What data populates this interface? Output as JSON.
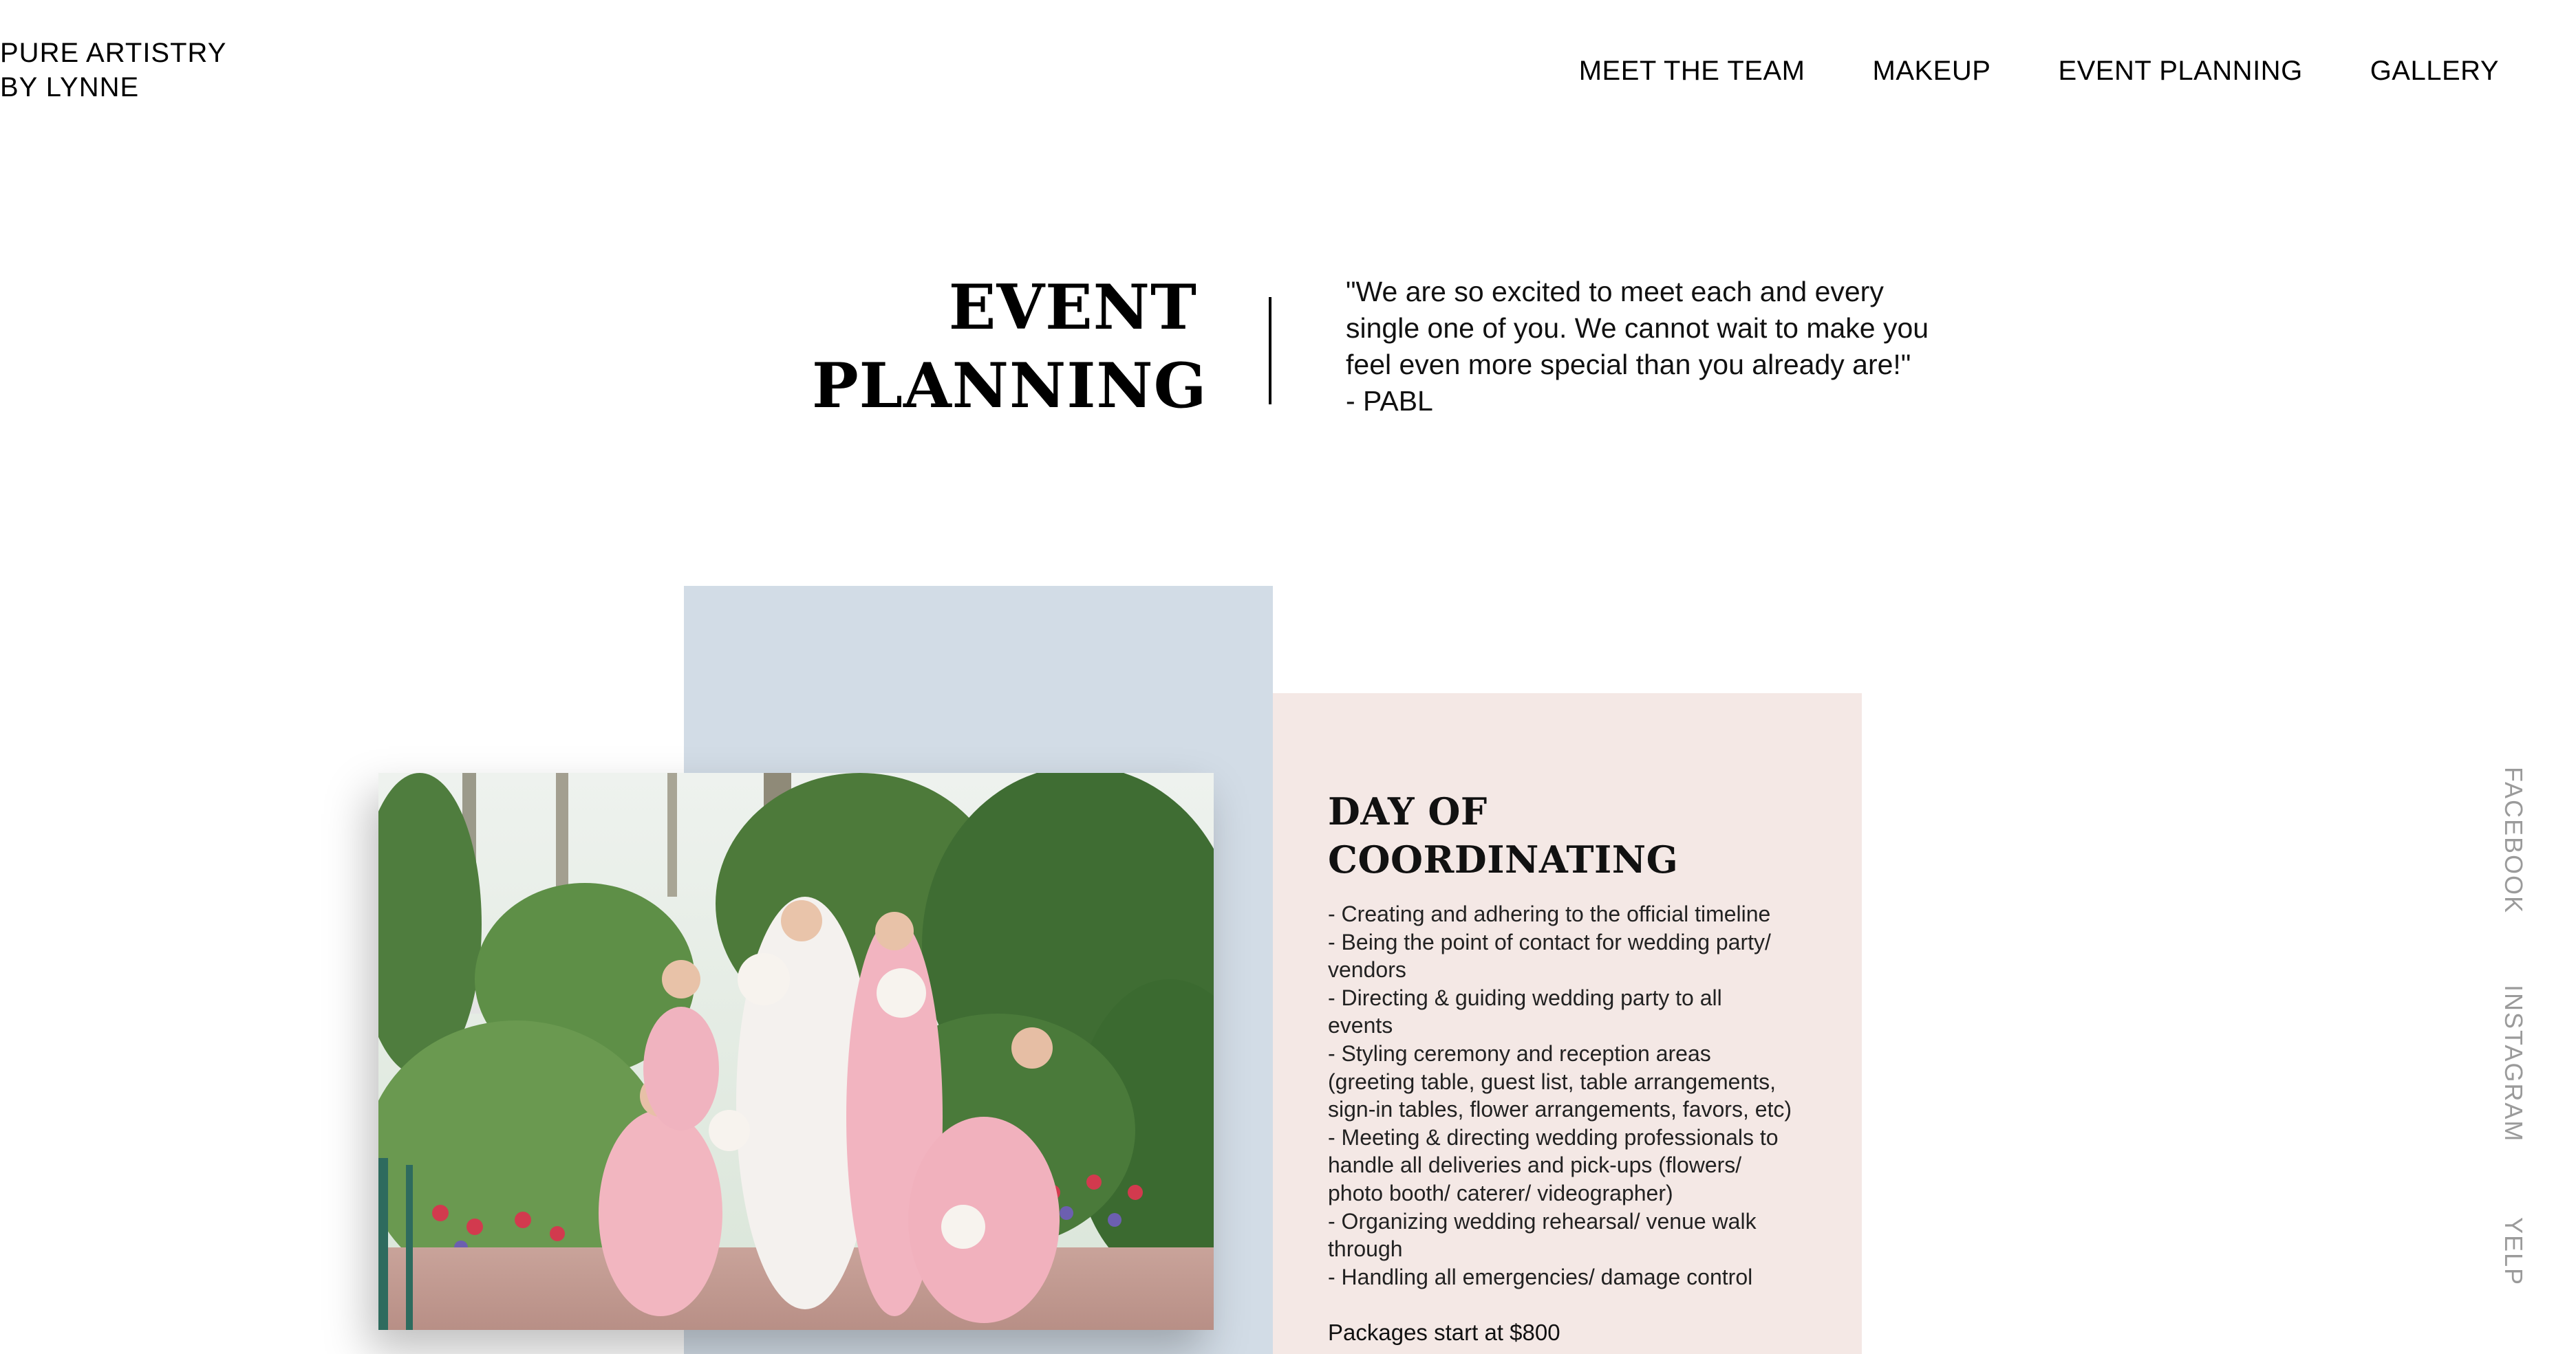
{
  "brand": {
    "line1": "PURE ARTISTRY",
    "line2": "BY LYNNE"
  },
  "nav": {
    "items": [
      "MEET THE TEAM",
      "MAKEUP",
      "EVENT PLANNING",
      "GALLERY"
    ]
  },
  "hero": {
    "title_line1": "EVENT",
    "title_line2": "PLANNING",
    "quote_lines": [
      "\"We are so excited to meet each and every",
      "single one of you. We cannot wait to make you",
      "feel even more special than you already are!\"",
      "- PABL"
    ]
  },
  "photo": {
    "icon": "bridal-party-photo"
  },
  "service": {
    "title": "DAY OF COORDINATING",
    "lines": [
      "- Creating and adhering to the official timeline",
      "- Being the point of contact for wedding party/",
      "vendors",
      "- Directing & guiding wedding party to all",
      "events",
      "- Styling ceremony and reception areas",
      "(greeting table, guest list, table arrangements,",
      "sign-in tables, flower arrangements, favors, etc)",
      "- Meeting & directing wedding professionals to",
      "handle all deliveries and pick-ups (flowers/",
      "photo booth/ caterer/ videographer)",
      "- Organizing wedding rehearsal/ venue walk",
      "through",
      "- Handling all emergencies/ damage control"
    ],
    "price": "Packages start at $800"
  },
  "social": {
    "facebook": "FACEBOOK",
    "instagram": "INSTAGRAM",
    "yelp": "YELP"
  },
  "colors": {
    "blue_block": "#d2dce6",
    "pink_block": "#f4e8e5",
    "social_text": "#9a9a9a"
  }
}
